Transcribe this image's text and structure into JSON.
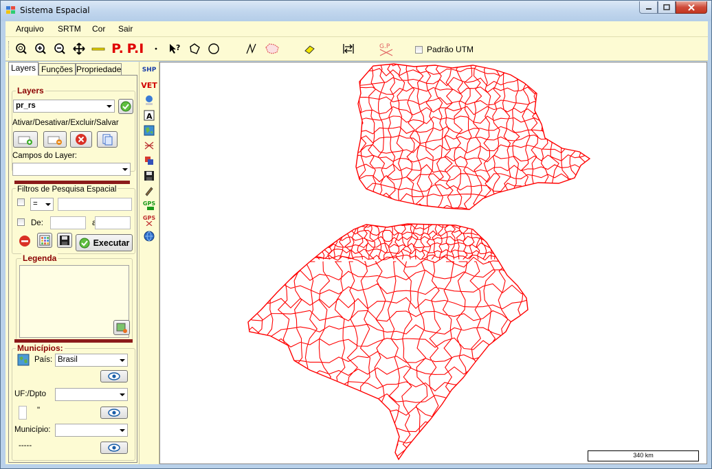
{
  "window": {
    "title": "Sistema Espacial"
  },
  "menu": [
    {
      "label": "Arquivo"
    },
    {
      "label": "SRTM"
    },
    {
      "label": "Cor"
    },
    {
      "label": "Sair"
    }
  ],
  "toolbar": {
    "tools": [
      {
        "icon": "zoom-area-icon"
      },
      {
        "icon": "zoom-in-icon"
      },
      {
        "icon": "zoom-out-icon"
      },
      {
        "icon": "pan-icon"
      },
      {
        "icon": "measure-ruler-icon"
      },
      {
        "icon": "point-P-icon",
        "text": "P."
      },
      {
        "icon": "points-PI-icon",
        "text": "P.I"
      },
      {
        "icon": "dot-icon"
      },
      {
        "icon": "identify-icon"
      },
      {
        "icon": "polygon-icon"
      },
      {
        "icon": "circle-icon"
      },
      {
        "icon": "polyline-icon"
      },
      {
        "icon": "polygon-select-icon"
      },
      {
        "icon": "eraser-icon"
      },
      {
        "icon": "extent-icon"
      },
      {
        "icon": "clear-gp-icon",
        "text": "G.P"
      }
    ],
    "utm_label": "Padrão UTM",
    "utm_checked": false
  },
  "tabs": [
    {
      "label": "Layers",
      "active": true
    },
    {
      "label": "Funções",
      "active": false
    },
    {
      "label": "Propriedade",
      "active": false
    }
  ],
  "layers": {
    "title": "Layers",
    "selected": "pr_rs",
    "actions_label": "Ativar/Desativar/Excluir/Salvar",
    "fields_label": "Campos do Layer:",
    "fields_value": ""
  },
  "filters": {
    "title": "Filtros de Pesquisa Espacial",
    "operator": "=",
    "value": "",
    "from_label": "De:",
    "to_label": "a",
    "execute_label": "Executar"
  },
  "legend": {
    "title": "Legenda"
  },
  "municipios": {
    "title": "Municípios:",
    "country_label": "País:",
    "country": "Brasil",
    "uf_label": "UF:/Dpto",
    "uf_value": "",
    "quote_text": "\"",
    "municipio_label": "Município:",
    "municipio_value": "",
    "dashes": "-----"
  },
  "side_tools": [
    {
      "icon": "shp-icon",
      "text": "SHP"
    },
    {
      "icon": "vet-icon",
      "text": "VET"
    },
    {
      "icon": "globe-doc-icon"
    },
    {
      "icon": "text-A-icon"
    },
    {
      "icon": "map-image-icon"
    },
    {
      "icon": "network-icon"
    },
    {
      "icon": "layers-user-icon"
    },
    {
      "icon": "save-icon"
    },
    {
      "icon": "pencil-icon"
    },
    {
      "icon": "gps-icon",
      "text": "GPS"
    },
    {
      "icon": "gps-clear-icon",
      "text": "GPS"
    },
    {
      "icon": "globe-icon"
    }
  ],
  "map": {
    "scale_label": "340 km",
    "line_color": "#ff0000"
  }
}
